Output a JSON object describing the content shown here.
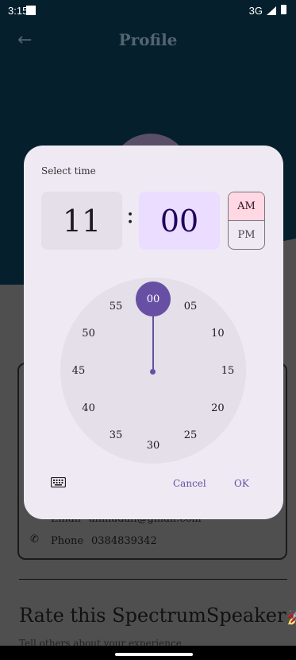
{
  "status_bar": {
    "time": "3:15",
    "network": "3G"
  },
  "header": {
    "title": "Profile",
    "back_icon": "arrow-left-icon"
  },
  "profile": {
    "email_label": "Email",
    "email_value": "ahmadali@gmail.com",
    "phone_label": "Phone",
    "phone_value": "0384839342"
  },
  "rate": {
    "title": "Rate this SpectrumSpeaker🚀",
    "subtitle": "Tell others about your experience"
  },
  "time_picker": {
    "title": "Select time",
    "hour": "11",
    "separator": ":",
    "minute": "00",
    "am_label": "AM",
    "pm_label": "PM",
    "selected_period": "AM",
    "dial_numbers": [
      "00",
      "05",
      "10",
      "15",
      "20",
      "25",
      "30",
      "35",
      "40",
      "45",
      "50",
      "55"
    ],
    "selected_minute": "00",
    "keyboard_icon": "keyboard-icon",
    "cancel_label": "Cancel",
    "ok_label": "OK",
    "accent_color": "#6750a4"
  }
}
